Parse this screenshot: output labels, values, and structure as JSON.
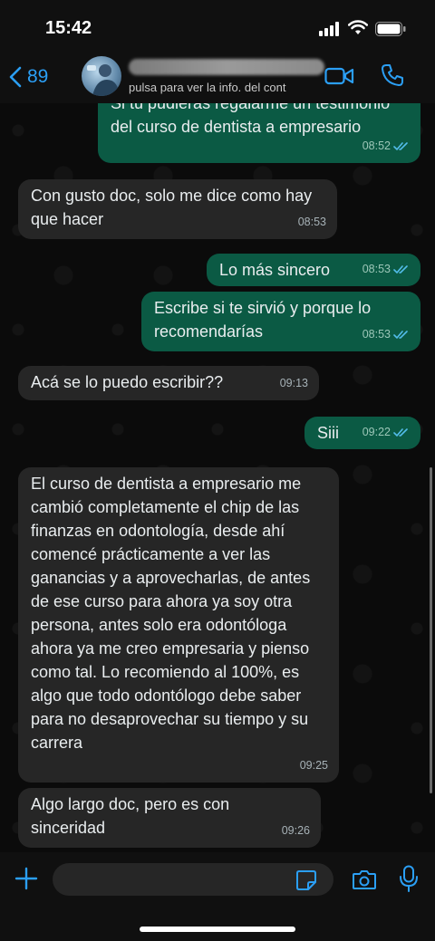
{
  "status_bar": {
    "time": "15:42"
  },
  "header": {
    "back_count": "89",
    "subtitle": "pulsa para ver la info. del cont"
  },
  "messages": [
    {
      "dir": "out",
      "text": "Si tu pudieras regalarme un testimonio del curso de dentista a empresario",
      "time": "08:52",
      "read": true
    },
    {
      "dir": "in",
      "text": "Con gusto doc, solo me dice como hay que hacer",
      "time": "08:53"
    },
    {
      "dir": "out",
      "text": "Lo más sincero",
      "time": "08:53",
      "read": true
    },
    {
      "dir": "out",
      "text": "Escribe si te sirvió y porque lo recomendarías",
      "time": "08:53",
      "read": true
    },
    {
      "dir": "in",
      "text": "Acá se lo puedo escribir??",
      "time": "09:13"
    },
    {
      "dir": "out",
      "text": "Siii",
      "time": "09:22",
      "read": true
    },
    {
      "dir": "in",
      "text": "El curso de dentista a empresario me cambió completamente el chip de las finanzas en odontología, desde ahí comencé prácticamente a ver las ganancias y a aprovecharlas, de antes de ese curso para ahora ya soy otra persona, antes solo era odontóloga ahora ya me creo empresaria y pienso como tal. Lo recomiendo al 100%, es algo que todo odontólogo debe saber para no desaprovechar su tiempo y su carrera",
      "time": "09:25"
    },
    {
      "dir": "in",
      "text": "Algo largo doc, pero es con sinceridad",
      "time": "09:26"
    }
  ],
  "colors": {
    "accent": "#2b9ff5",
    "outgoing": "#0b5a44",
    "incoming": "#262626",
    "read_ticks": "#53bdeb"
  }
}
